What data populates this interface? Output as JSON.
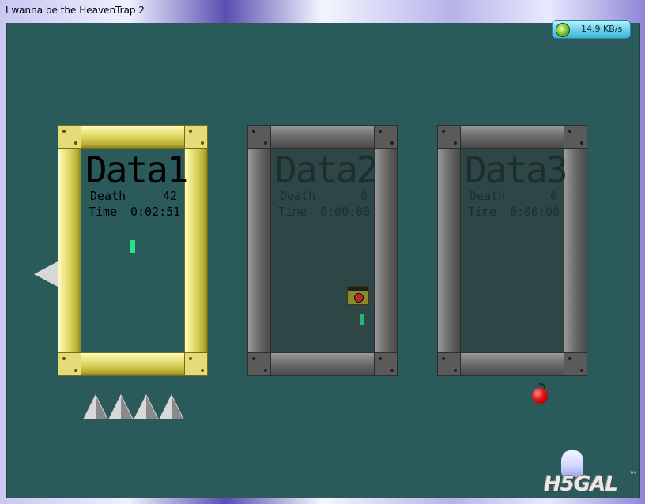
{
  "window": {
    "title": "I wanna be the HeavenTrap 2"
  },
  "network_speed": {
    "value": "14.9 KB/s",
    "icon": "network-globe-icon"
  },
  "save_slots": [
    {
      "label": "Data1",
      "death_label": "Death",
      "death_value": "42",
      "time_label": "Time",
      "time_value": "0:02:51",
      "selected": true,
      "frame_color": "#d8d05c"
    },
    {
      "label": "Data2",
      "death_label": "Death",
      "death_value": "0",
      "time_label": "Time",
      "time_value": "0:00:00",
      "selected": false,
      "frame_color": "#636363"
    },
    {
      "label": "Data3",
      "death_label": "Death",
      "death_value": "0",
      "time_label": "Time",
      "time_value": "0:00:00",
      "selected": false,
      "frame_color": "#636363"
    }
  ],
  "colors": {
    "background": "#2b5a5b",
    "player_marker": "#2fe08a",
    "apple": "#e01010"
  },
  "decorations": {
    "spike_count_bottom": 4
  },
  "watermark": {
    "text": "H5GAL",
    "tm": "™"
  }
}
